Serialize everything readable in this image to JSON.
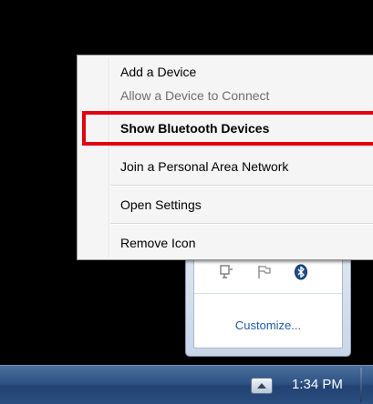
{
  "context_menu": {
    "items": [
      {
        "label": "Add a Device",
        "enabled": true,
        "bold": false
      },
      {
        "label": "Allow a Device to Connect",
        "enabled": false,
        "bold": false
      },
      {
        "label": "Show Bluetooth Devices",
        "enabled": true,
        "bold": true
      },
      {
        "label": "Join a Personal Area Network",
        "enabled": true,
        "bold": false
      },
      {
        "label": "Open Settings",
        "enabled": true,
        "bold": false
      },
      {
        "label": "Remove Icon",
        "enabled": true,
        "bold": false
      }
    ],
    "highlighted_item": "Show Bluetooth Devices",
    "highlight_color": "#e3000f"
  },
  "tray_overflow": {
    "icons": [
      "network-plug-icon",
      "flag-icon",
      "bluetooth-icon"
    ],
    "customize_label": "Customize...",
    "link_color": "#1e5ba8"
  },
  "taskbar": {
    "show_hidden_icon": "chevron-up-icon",
    "clock": "1:34 PM"
  }
}
